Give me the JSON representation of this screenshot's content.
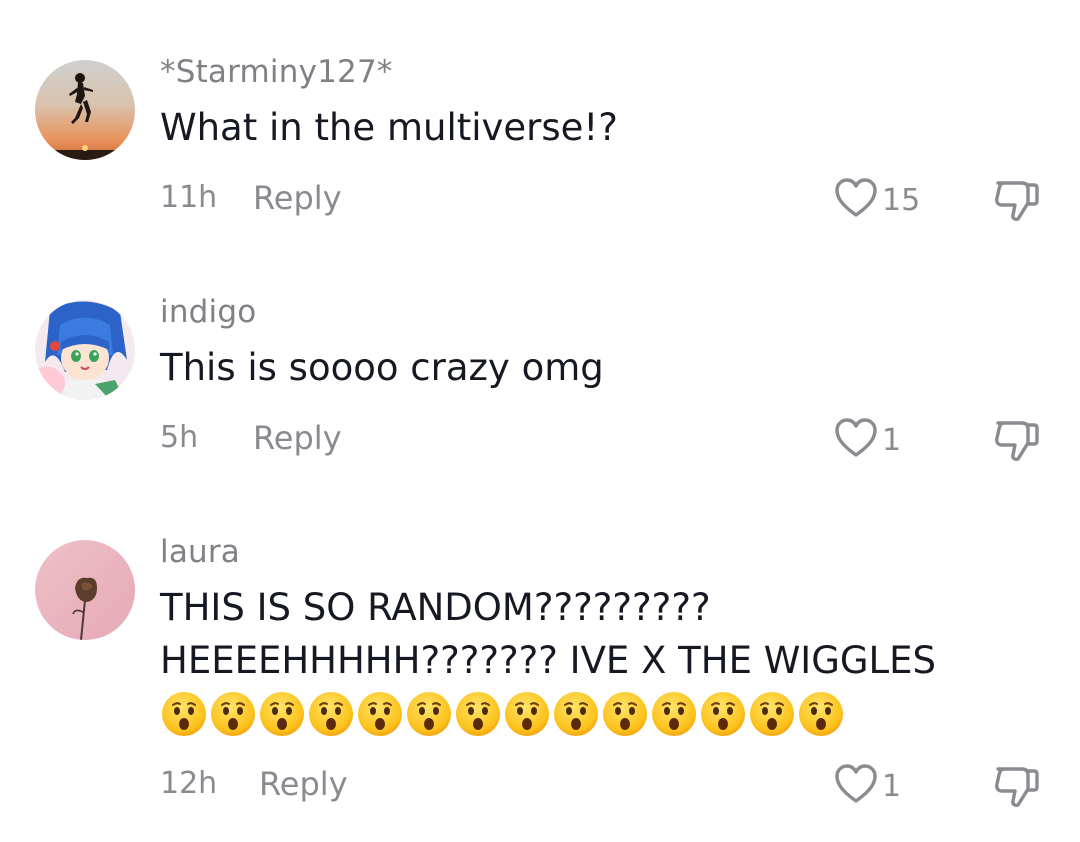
{
  "comments": [
    {
      "username": "*Starminy127*",
      "text": "What in the multiverse!?",
      "time": "11h",
      "reply_label": "Reply",
      "likes": "15",
      "avatar_icon": "sunset-silhouette-avatar"
    },
    {
      "username": "indigo",
      "text": "This is soooo crazy omg",
      "time": "5h",
      "reply_label": "Reply",
      "likes": "1",
      "avatar_icon": "anime-girl-avatar"
    },
    {
      "username": "laura",
      "text_line1": "THIS IS SO RANDOM?????????",
      "text_line2": "HEEEEHHHHH??????? IVE X THE WIGGLES",
      "emoji": "hushed-face-emoji",
      "emoji_count": 14,
      "time": "12h",
      "reply_label": "Reply",
      "likes": "1",
      "avatar_icon": "rose-avatar"
    }
  ],
  "colors": {
    "username": "#808086",
    "text": "#161823",
    "meta": "#8a8b91",
    "icon_stroke": "#8a8b91"
  }
}
